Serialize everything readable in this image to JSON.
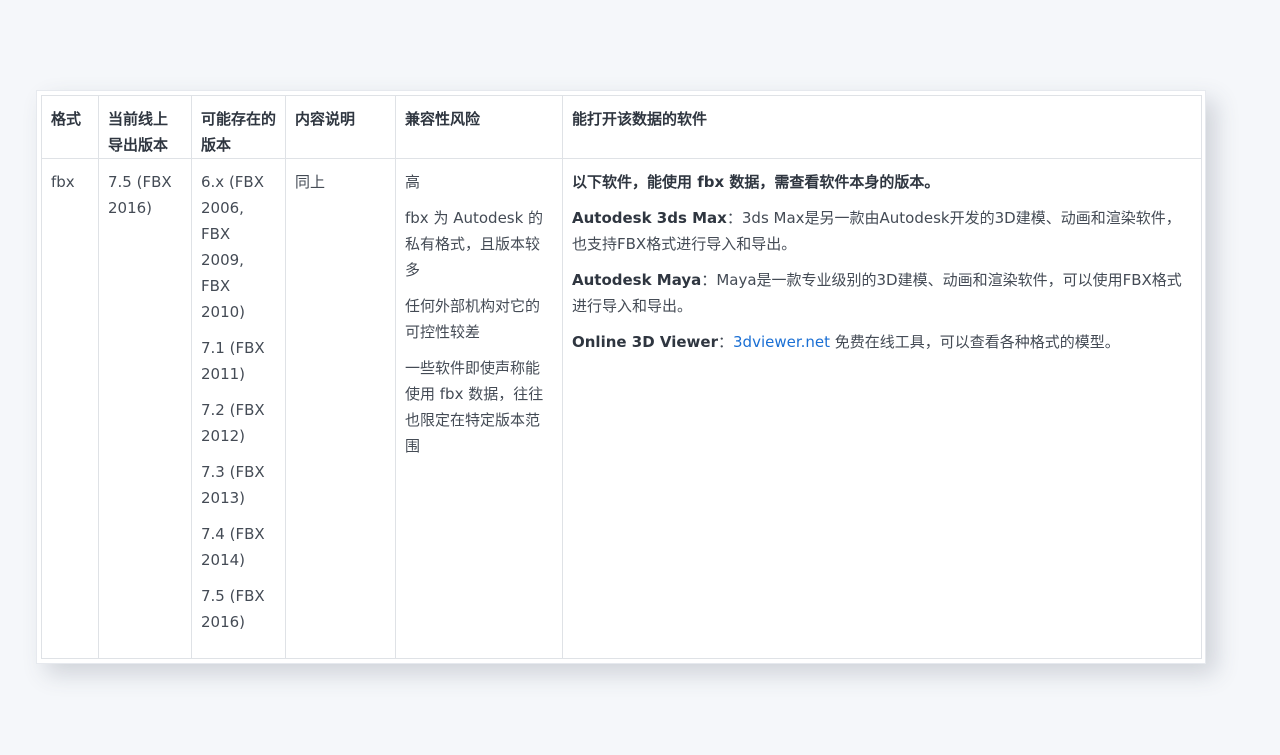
{
  "table": {
    "headers": [
      "格式",
      "当前线上导出版本",
      "可能存在的版本",
      "内容说明",
      "兼容性风险",
      "能打开该数据的软件"
    ],
    "rows": [
      {
        "format": "fbx",
        "current_version": "7.5 (FBX 2016)",
        "possible_versions": [
          "6.x (FBX 2006, FBX 2009, FBX 2010)",
          "7.1 (FBX 2011)",
          "7.2 (FBX 2012)",
          "7.3 (FBX 2013)",
          "7.4 (FBX 2014)",
          "7.5 (FBX 2016)"
        ],
        "description": "同上",
        "risks": [
          "高",
          "fbx 为 Autodesk 的私有格式，且版本较多",
          "任何外部机构对它的可控性较差",
          "一些软件即使声称能使用 fbx 数据，往往也限定在特定版本范围"
        ],
        "software": {
          "intro": "以下软件，能使用 fbx 数据，需查看软件本身的版本。",
          "items": [
            {
              "name": "Autodesk 3ds Max",
              "sep": "：",
              "text": "3ds Max是另一款由Autodesk开发的3D建模、动画和渲染软件，也支持FBX格式进行导入和导出。"
            },
            {
              "name": "Autodesk Maya",
              "sep": "：",
              "text": "Maya是一款专业级别的3D建模、动画和渲染软件，可以使用FBX格式进行导入和导出。"
            },
            {
              "name": "Online 3D Viewer",
              "sep": "：",
              "link": "3dviewer.net",
              "text": " 免费在线工具，可以查看各种格式的模型。"
            }
          ]
        }
      }
    ]
  },
  "colors": {
    "background": "#f5f7fa",
    "link": "#1a6fd4",
    "border": "#dfe2e6",
    "text": "#444b55"
  }
}
